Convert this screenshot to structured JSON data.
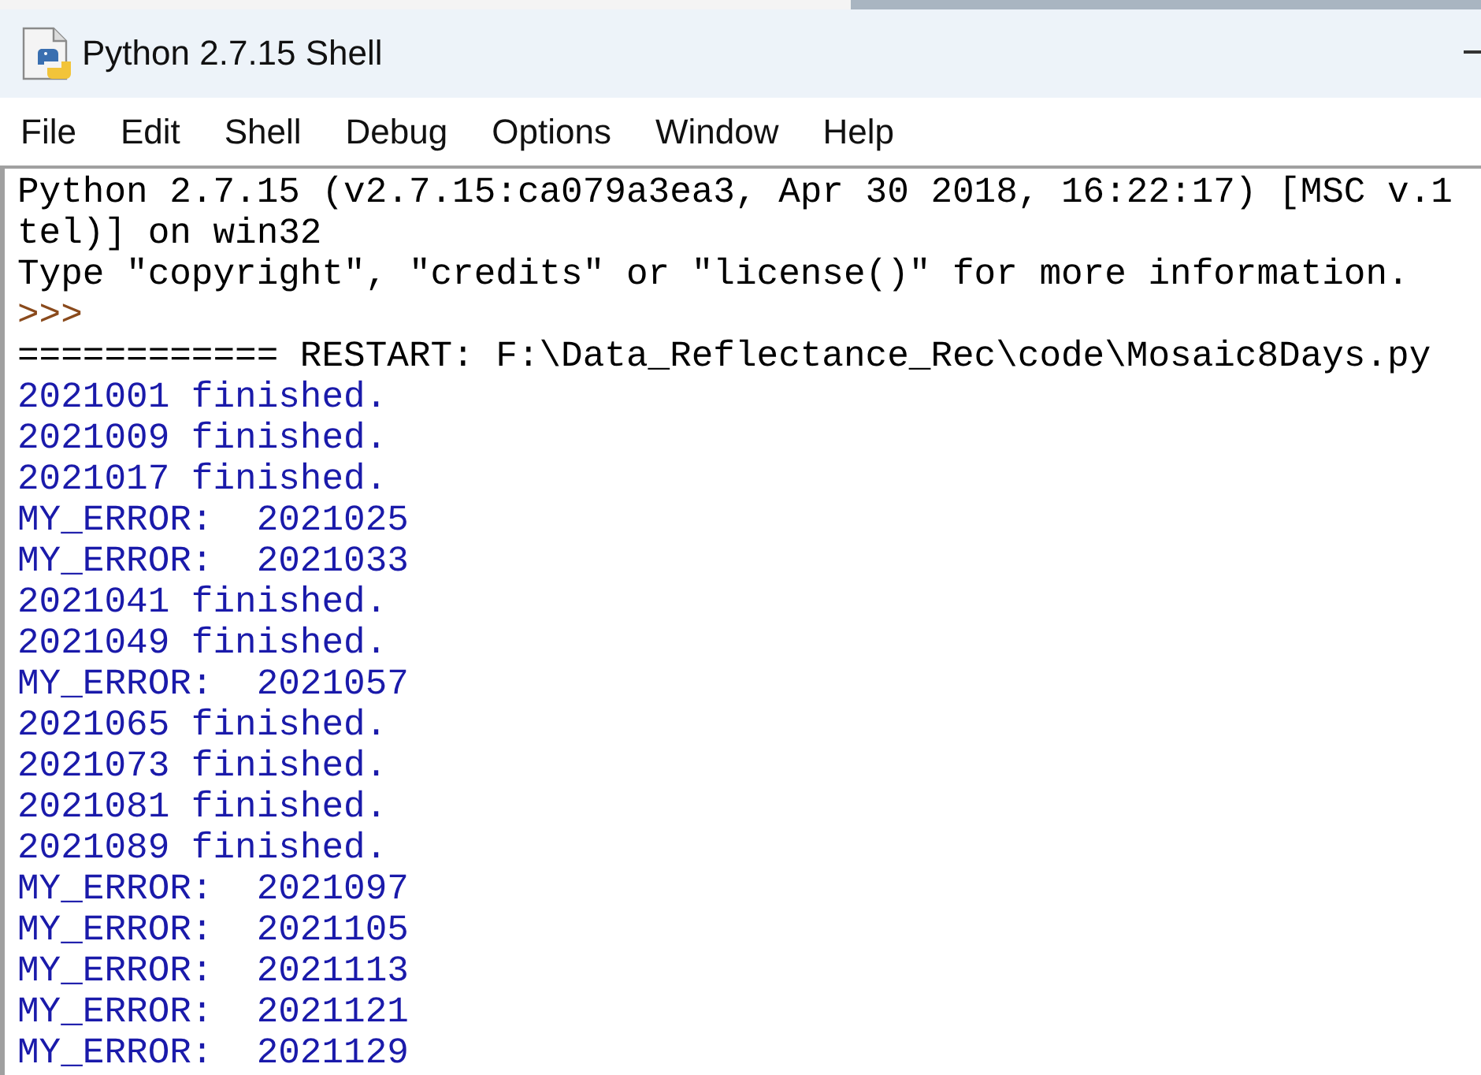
{
  "window": {
    "title": "Python 2.7.15 Shell"
  },
  "menu": [
    "File",
    "Edit",
    "Shell",
    "Debug",
    "Options",
    "Window",
    "Help"
  ],
  "shell": {
    "lines": [
      {
        "kind": "banner",
        "text": "Python 2.7.15 (v2.7.15:ca079a3ea3, Apr 30 2018, 16:22:17) [MSC v.1"
      },
      {
        "kind": "banner",
        "text": "tel)] on win32"
      },
      {
        "kind": "banner",
        "text": "Type \"copyright\", \"credits\" or \"license()\" for more information."
      },
      {
        "kind": "prompt",
        "text": ">>>"
      },
      {
        "kind": "restart",
        "text": "============ RESTART: F:\\Data_Reflectance_Rec\\code\\Mosaic8Days.py"
      },
      {
        "kind": "stdout",
        "text": "2021001 finished."
      },
      {
        "kind": "stdout",
        "text": "2021009 finished."
      },
      {
        "kind": "stdout",
        "text": "2021017 finished."
      },
      {
        "kind": "stdout",
        "text": "MY_ERROR:  2021025"
      },
      {
        "kind": "stdout",
        "text": "MY_ERROR:  2021033"
      },
      {
        "kind": "stdout",
        "text": "2021041 finished."
      },
      {
        "kind": "stdout",
        "text": "2021049 finished."
      },
      {
        "kind": "stdout",
        "text": "MY_ERROR:  2021057"
      },
      {
        "kind": "stdout",
        "text": "2021065 finished."
      },
      {
        "kind": "stdout",
        "text": "2021073 finished."
      },
      {
        "kind": "stdout",
        "text": "2021081 finished."
      },
      {
        "kind": "stdout",
        "text": "2021089 finished."
      },
      {
        "kind": "stdout",
        "text": "MY_ERROR:  2021097"
      },
      {
        "kind": "stdout",
        "text": "MY_ERROR:  2021105"
      },
      {
        "kind": "stdout",
        "text": "MY_ERROR:  2021113"
      },
      {
        "kind": "stdout",
        "text": "MY_ERROR:  2021121"
      },
      {
        "kind": "stdout",
        "text": "MY_ERROR:  2021129"
      }
    ]
  }
}
